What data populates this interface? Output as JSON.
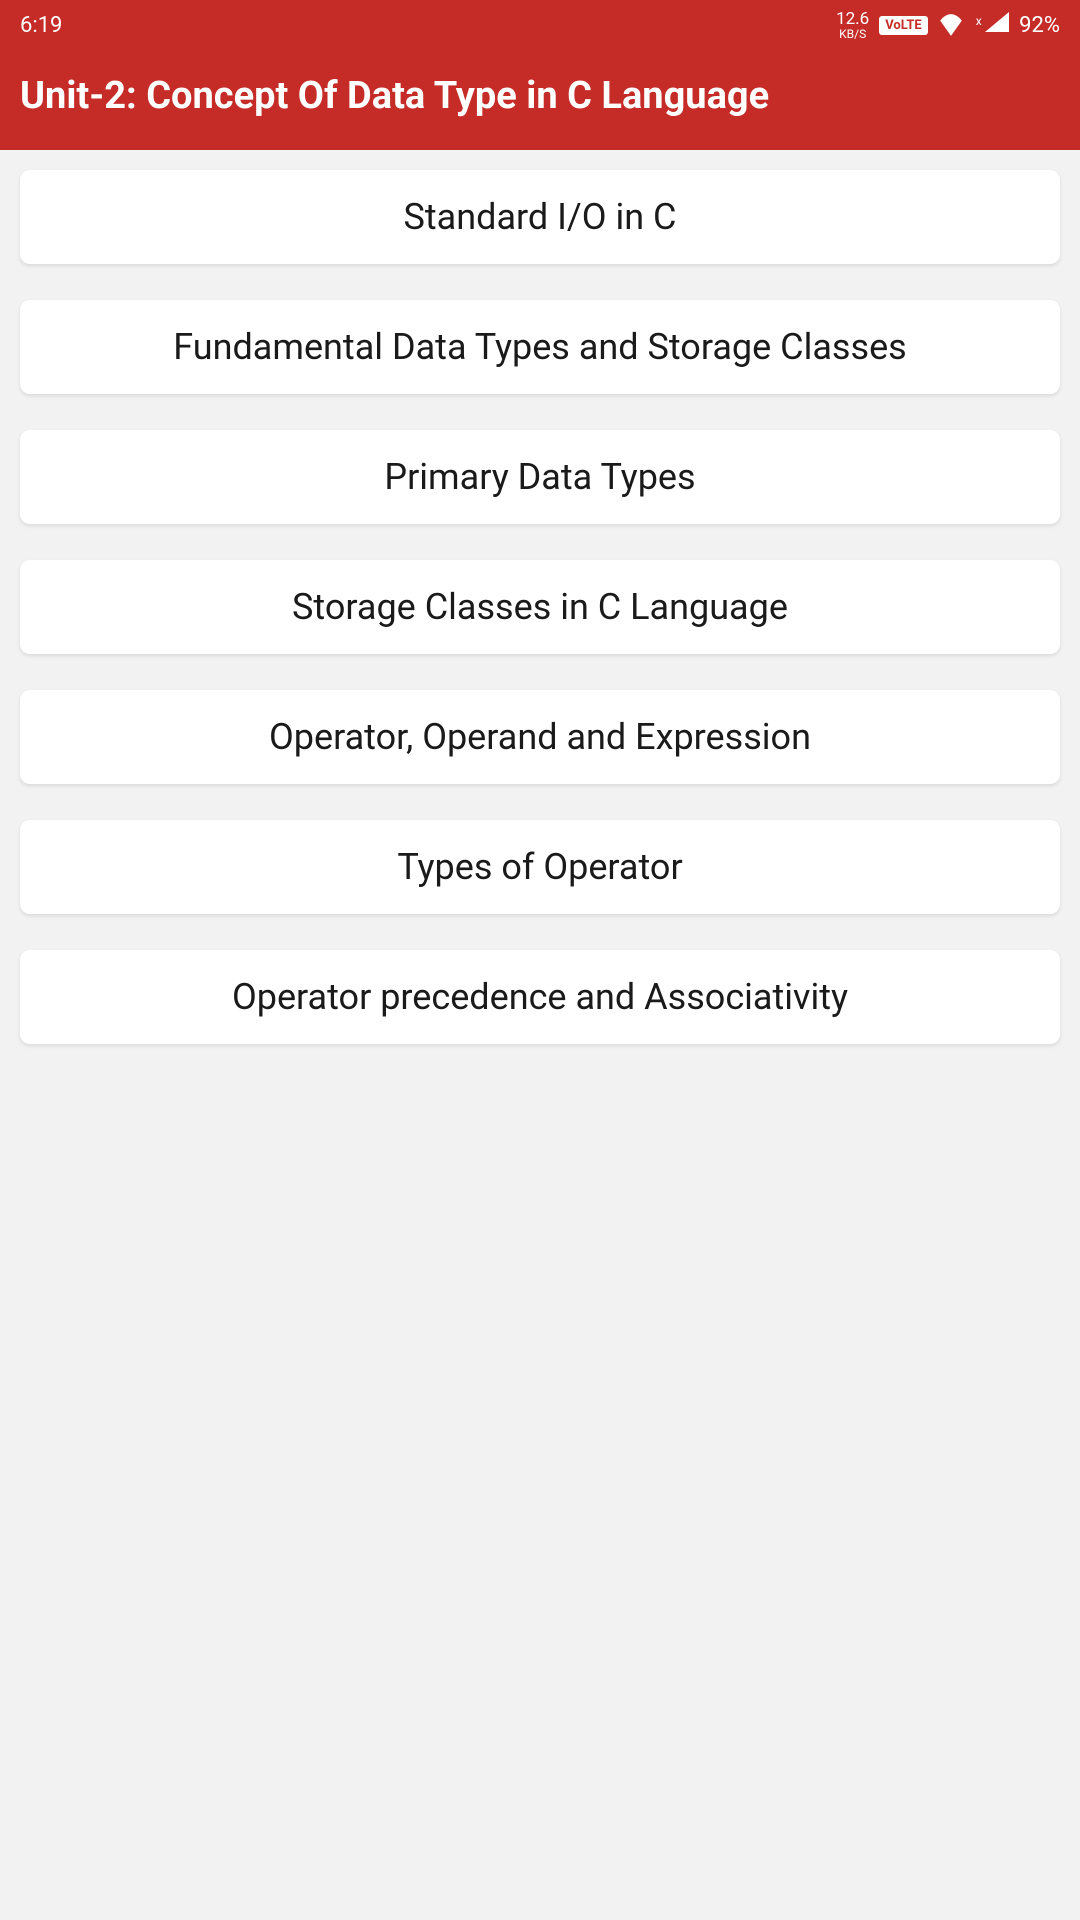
{
  "statusBar": {
    "time": "6:19",
    "networkSpeed": "12.6",
    "networkUnit": "KB/S",
    "volte": "VoLTE",
    "signalX": "x",
    "battery": "92%"
  },
  "header": {
    "title": "Unit-2: Concept Of Data Type in C Language"
  },
  "items": [
    "Standard I/O in C",
    "Fundamental Data Types and Storage Classes",
    "Primary Data Types",
    "Storage Classes in C Language",
    "Operator, Operand and Expression",
    "Types of Operator",
    "Operator precedence and Associativity"
  ]
}
